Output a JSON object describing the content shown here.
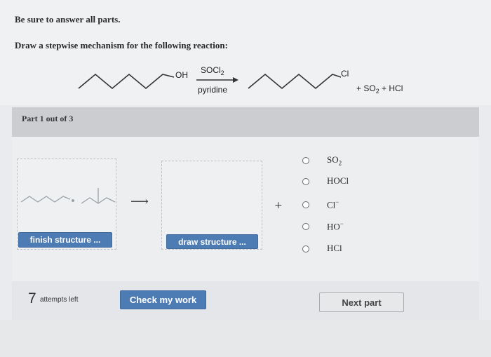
{
  "instruction": "Be sure to answer all parts.",
  "question": "Draw a stepwise mechanism for the following reaction:",
  "reaction": {
    "reactant_group": "OH",
    "reagent": "SOCl",
    "reagent_subscript": "2",
    "conditions": "pyridine",
    "product_group": "Cl",
    "byproducts_prefix": "+ SO",
    "byproducts_subscript": "2",
    "byproducts_suffix": " + HCl"
  },
  "part_label": "Part 1 out of 3",
  "mechanism": {
    "arrow": "⟶",
    "plus": "+",
    "finish_button": "finish structure ...",
    "draw_button": "draw structure ..."
  },
  "options": [
    {
      "label": "SO",
      "sub": "2",
      "sup": ""
    },
    {
      "label": "HOCl",
      "sub": "",
      "sup": ""
    },
    {
      "label": "Cl",
      "sub": "",
      "sup": "−"
    },
    {
      "label": "HO",
      "sub": "",
      "sup": "−"
    },
    {
      "label": "HCl",
      "sub": "",
      "sup": ""
    }
  ],
  "footer": {
    "attempts_count": "7",
    "attempts_text": "attempts left",
    "check_button": "Check my work",
    "next_button": "Next part"
  }
}
